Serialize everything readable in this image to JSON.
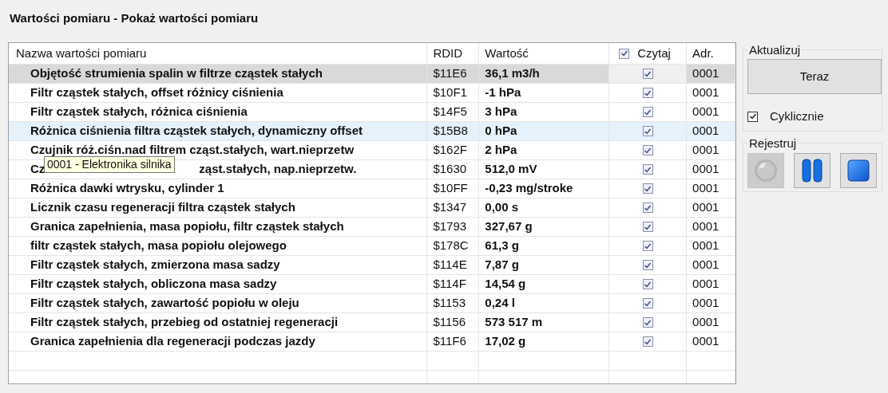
{
  "title": "Wartości pomiaru - Pokaż wartości pomiaru",
  "table": {
    "columns": [
      {
        "label": "Nazwa wartości pomiaru"
      },
      {
        "label": "RDID"
      },
      {
        "label": "Wartość"
      },
      {
        "label": "Czytaj",
        "checked": true
      },
      {
        "label": "Adr."
      }
    ],
    "rows": [
      {
        "name": "Objętość strumienia spalin w filtrze cząstek stałych",
        "rdid": "$11E6",
        "value": "36,1 m3/h",
        "read": true,
        "adr": "0001",
        "selected": true,
        "hovered": false
      },
      {
        "name": "Filtr cząstek stałych, offset różnicy ciśnienia",
        "rdid": "$10F1",
        "value": "-1 hPa",
        "read": true,
        "adr": "0001",
        "selected": false,
        "hovered": false
      },
      {
        "name": "Filtr cząstek stałych, różnica ciśnienia",
        "rdid": "$14F5",
        "value": "3 hPa",
        "read": true,
        "adr": "0001",
        "selected": false,
        "hovered": false
      },
      {
        "name": "Różnica ciśnienia filtra cząstek stałych, dynamiczny offset",
        "rdid": "$15B8",
        "value": "0 hPa",
        "read": true,
        "adr": "0001",
        "selected": false,
        "hovered": true
      },
      {
        "name": "Czujnik róż.ciśn.nad filtrem cząst.stałych, wart.nieprzetw",
        "rdid": "$162F",
        "value": "2 hPa",
        "read": true,
        "adr": "0001",
        "selected": false,
        "hovered": false
      },
      {
        "name_parts": [
          "Cz",
          "ząst.stałych, nap.nieprzetw."
        ],
        "rdid": "$1630",
        "value": "512,0 mV",
        "read": true,
        "adr": "0001",
        "selected": false,
        "hovered": false
      },
      {
        "name": "Różnica dawki wtrysku, cylinder 1",
        "rdid": "$10FF",
        "value": "-0,23 mg/stroke",
        "read": true,
        "adr": "0001",
        "selected": false,
        "hovered": false
      },
      {
        "name": "Licznik czasu regeneracji filtra cząstek stałych",
        "rdid": "$1347",
        "value": "0,00 s",
        "read": true,
        "adr": "0001",
        "selected": false,
        "hovered": false
      },
      {
        "name": "Granica zapełnienia, masa popiołu, filtr cząstek stałych",
        "rdid": "$1793",
        "value": "327,67 g",
        "read": true,
        "adr": "0001",
        "selected": false,
        "hovered": false
      },
      {
        "name": "filtr cząstek stałych, masa popiołu olejowego",
        "rdid": "$178C",
        "value": "61,3 g",
        "read": true,
        "adr": "0001",
        "selected": false,
        "hovered": false
      },
      {
        "name": "Filtr cząstek stałych, zmierzona masa sadzy",
        "rdid": "$114E",
        "value": "7,87 g",
        "read": true,
        "adr": "0001",
        "selected": false,
        "hovered": false
      },
      {
        "name": "Filtr cząstek stałych, obliczona masa sadzy",
        "rdid": "$114F",
        "value": "14,54 g",
        "read": true,
        "adr": "0001",
        "selected": false,
        "hovered": false
      },
      {
        "name": "Filtr cząstek stałych, zawartość popiołu w oleju",
        "rdid": "$1153",
        "value": "0,24 l",
        "read": true,
        "adr": "0001",
        "selected": false,
        "hovered": false
      },
      {
        "name": "Filtr cząstek stałych, przebieg od ostatniej regeneracji",
        "rdid": "$1156",
        "value": "573 517 m",
        "read": true,
        "adr": "0001",
        "selected": false,
        "hovered": false
      },
      {
        "name": "Granica zapełnienia dla regeneracji podczas jazdy",
        "rdid": "$11F6",
        "value": "17,02 g",
        "read": true,
        "adr": "0001",
        "selected": false,
        "hovered": false
      }
    ]
  },
  "tooltip": "0001 - Elektronika silnika",
  "update_group": {
    "title": "Aktualizuj",
    "button": "Teraz",
    "cyclic": {
      "label": "Cyklicznie",
      "checked": true
    }
  },
  "record_group": {
    "title": "Rejestruj",
    "buttons": [
      {
        "kind": "record",
        "disabled": true
      },
      {
        "kind": "pause",
        "disabled": false
      },
      {
        "kind": "stop",
        "disabled": false
      }
    ]
  }
}
